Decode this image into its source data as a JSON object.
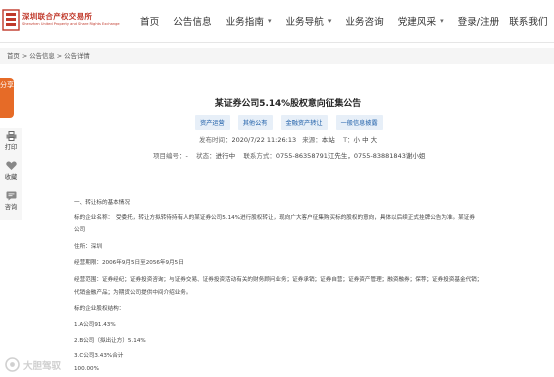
{
  "header": {
    "logo_cn": "深圳联合产权交易所",
    "logo_en": "Shenzhen United Property and Share Rights Exchange",
    "nav": [
      {
        "label": "首页",
        "has_caret": false
      },
      {
        "label": "公告信息",
        "has_caret": false
      },
      {
        "label": "业务指南",
        "has_caret": true
      },
      {
        "label": "业务导航",
        "has_caret": true
      },
      {
        "label": "业务咨询",
        "has_caret": false
      },
      {
        "label": "党建风采",
        "has_caret": true
      },
      {
        "label": "登录/注册",
        "has_caret": false
      },
      {
        "label": "联系我们",
        "has_caret": false
      }
    ]
  },
  "breadcrumb": "首页 > 公告信息 > 公告详情",
  "sidebar": {
    "share_label": "分享",
    "tools": [
      {
        "icon": "printer-icon",
        "label": "打印"
      },
      {
        "icon": "heart-icon",
        "label": "收藏"
      },
      {
        "icon": "chat-icon",
        "label": "咨询"
      }
    ]
  },
  "article": {
    "title": "某证券公司5.14%股权意向征集公告",
    "tags": [
      "资产运营",
      "其他公有",
      "金融资产转让",
      "一般信息披露"
    ],
    "publish_label": "发布时间：",
    "publish_time": "2020/7/22 11:26:13",
    "source_label": "来源：",
    "source": "本站",
    "font_label": "T：",
    "font_sizes": "小 中 大",
    "project_no_label": "项目编号：",
    "project_no": "-",
    "status_label": "状态：",
    "status": "进行中",
    "contact_label": "联系方式：",
    "contact": "0755-86358791江先生，0755-83881843谢小姐",
    "paragraphs": [
      "一、转让标的基本情况",
      "标的企业名称：　受委托，转让方拟转待持有人的某证券公司5.14%进行股权转让，现向广大客户征集购买标的股权的意向，具体以后续正式挂牌公告为准。某证券",
      "公司",
      "住所：深圳",
      "经营期限：2006年9月5日至2056年9月5日",
      "经营范围：证券经纪；证券投资咨询；与证券交易、证券投资活动有关的财务顾问业务；证券承销；证券自营；证券资产管理；融资融券；保荐；证券投资基金代销；",
      "代销金融产品；为期货公司提供中间介绍业务。",
      "标的企业股权结构：",
      "1.A公司91.43%",
      "2.B公司（拟出让方）5.14%",
      "3.C公司3.43%合计",
      "100.00%"
    ]
  },
  "watermark": "大胆驾驭"
}
